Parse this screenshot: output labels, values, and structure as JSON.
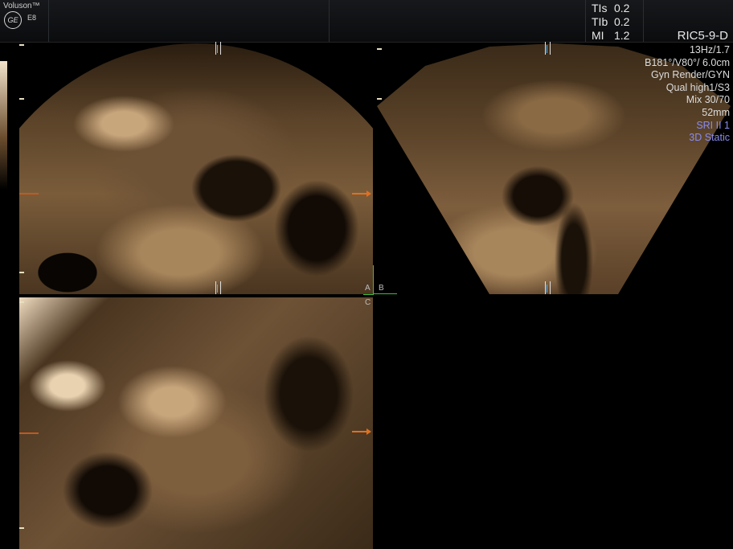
{
  "header": {
    "brand": "Voluson™",
    "logo": "GE",
    "model": "E8",
    "tis_label": "TIs",
    "tis_value": "0.2",
    "tib_label": "TIb",
    "tib_value": "0.2",
    "mi_label": "MI",
    "mi_value": "1.2",
    "probe": "RIC5-9-D"
  },
  "params": [
    "13Hz/1.7",
    "B181°/V80°/ 6.0cm",
    "Gyn Render/GYN",
    "Qual high1/S3",
    "Mix 30/70",
    "52mm",
    "SRI II 1",
    "3D Static"
  ],
  "panels": {
    "a": "A",
    "b": "B",
    "c": "C"
  },
  "colors": {
    "accent_blue_text": "#8a8cf0",
    "marker_orange": "#e07020",
    "corner_green": "#3bbf3b",
    "marker_blue": "#4ab0ff"
  }
}
